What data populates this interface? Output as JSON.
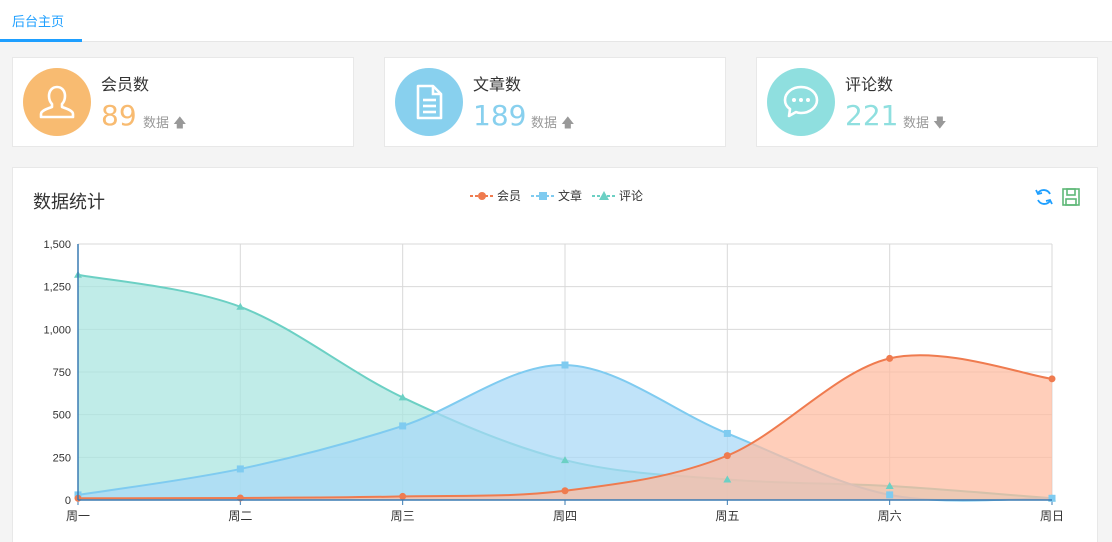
{
  "tabs": {
    "home_label": "后台主页"
  },
  "cards": [
    {
      "title": "会员数",
      "value": "89",
      "sub_label": "数据",
      "trend": "up",
      "color": "#f8bb71",
      "icon": "user-icon"
    },
    {
      "title": "文章数",
      "value": "189",
      "sub_label": "数据",
      "trend": "up",
      "color": "#88d0ee",
      "icon": "document-icon"
    },
    {
      "title": "评论数",
      "value": "221",
      "sub_label": "数据",
      "trend": "down",
      "color": "#8fdfdf",
      "icon": "comment-icon"
    }
  ],
  "panel": {
    "title": "数据统计"
  },
  "toolbox": {
    "refresh_icon": "refresh-icon",
    "save_icon": "save-icon"
  },
  "chart_data": {
    "type": "area",
    "categories": [
      "周一",
      "周二",
      "周三",
      "周四",
      "周五",
      "周六",
      "周日"
    ],
    "ylim": [
      0,
      1500
    ],
    "yticks": [
      "0",
      "250",
      "500",
      "750",
      "1,000",
      "1,250",
      "1,500"
    ],
    "series": [
      {
        "name": "会员",
        "marker": "circle",
        "color": "#ef7b4f",
        "fill": "#ffbba0",
        "values": [
          10,
          12,
          21,
          54,
          260,
          830,
          710
        ]
      },
      {
        "name": "文章",
        "marker": "square",
        "color": "#7fcbf0",
        "fill": "#a7d8f7",
        "values": [
          30,
          182,
          434,
          791,
          390,
          30,
          10
        ]
      },
      {
        "name": "评论",
        "marker": "triangle",
        "color": "#6cd0c4",
        "fill": "#a7e5df",
        "values": [
          1320,
          1132,
          601,
          234,
          120,
          82,
          10
        ]
      }
    ]
  }
}
